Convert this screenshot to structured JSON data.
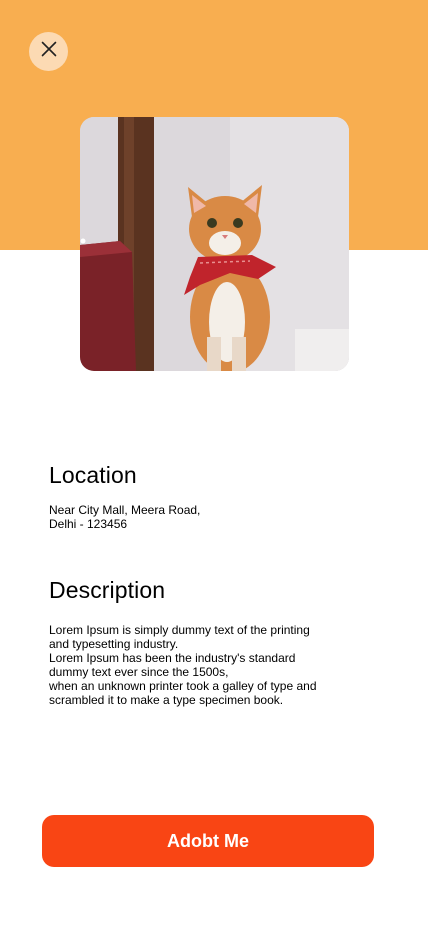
{
  "header": {
    "close_icon": "close-icon",
    "background_color": "#F8AE50"
  },
  "pet": {
    "photo_description_icon": "cat-photo"
  },
  "location": {
    "title": "Location",
    "text": "Near City Mall, Meera Road,\nDelhi - 123456"
  },
  "description": {
    "title": "Description",
    "text": "Lorem Ipsum is simply dummy text of the printing\nand typesetting industry.\nLorem Ipsum has been the industry's standard\ndummy text ever since the 1500s,\nwhen an unknown printer took a galley of type and\nscrambled it to make a type specimen book."
  },
  "action": {
    "adopt_label": "Adobt Me",
    "color": "#F94514"
  }
}
